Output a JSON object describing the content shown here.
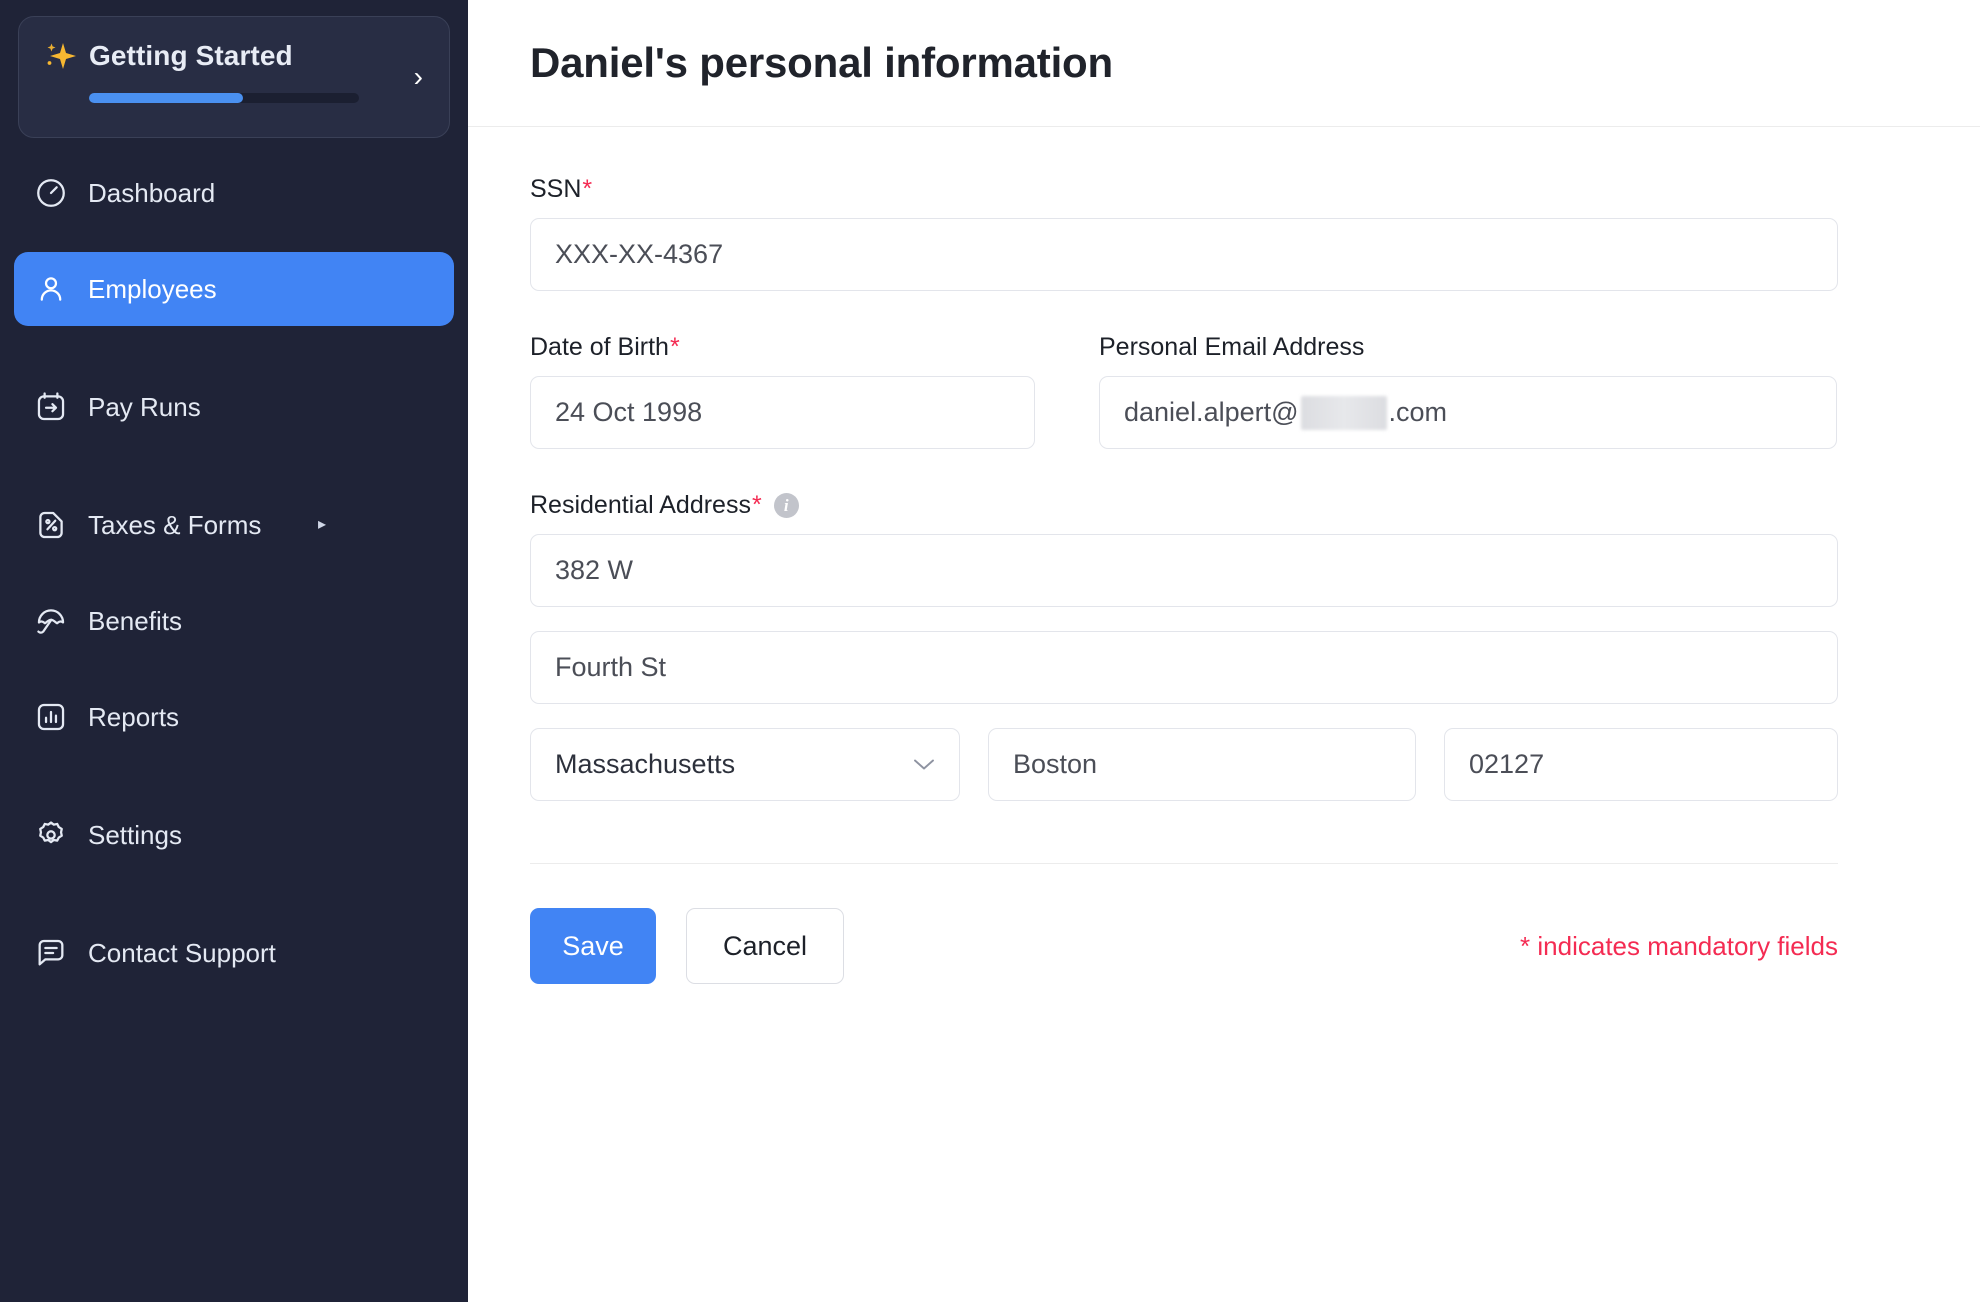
{
  "sidebar": {
    "getting_started": {
      "title": "Getting Started",
      "progress_percent": 57,
      "chevron": "›",
      "sparkle_icon": "sparkle-icon"
    },
    "items": [
      {
        "label": "Dashboard",
        "icon": "gauge-icon",
        "active": false,
        "expandable": false
      },
      {
        "label": "Employees",
        "icon": "person-icon",
        "active": true,
        "expandable": false
      },
      {
        "label": "Pay Runs",
        "icon": "calendar-arrow-icon",
        "active": false,
        "expandable": false
      },
      {
        "label": "Taxes & Forms",
        "icon": "percent-document-icon",
        "active": false,
        "expandable": true,
        "expand_glyph": "▸"
      },
      {
        "label": "Benefits",
        "icon": "umbrella-icon",
        "active": false,
        "expandable": false
      },
      {
        "label": "Reports",
        "icon": "bar-chart-icon",
        "active": false,
        "expandable": false
      },
      {
        "label": "Settings",
        "icon": "gear-icon",
        "active": false,
        "expandable": false
      },
      {
        "label": "Contact Support",
        "icon": "chat-bubble-icon",
        "active": false,
        "expandable": false
      }
    ]
  },
  "header": {
    "title": "Daniel's personal information"
  },
  "form": {
    "ssn": {
      "label": "SSN",
      "required_marker": "*",
      "value": "XXX-XX-4367"
    },
    "date_of_birth": {
      "label": "Date of Birth",
      "required_marker": "*",
      "value": "24 Oct 1998"
    },
    "personal_email": {
      "label": "Personal Email Address",
      "value_prefix": "daniel.alpert@",
      "value_suffix": ".com",
      "redacted": true
    },
    "residential_address": {
      "label": "Residential Address",
      "required_marker": "*",
      "info_icon": "info-icon",
      "info_glyph": "i",
      "line1": "382 W",
      "line2": "Fourth St",
      "state": "Massachusetts",
      "state_chevron": "⌄",
      "city": "Boston",
      "zip": "02127"
    }
  },
  "footer": {
    "save_label": "Save",
    "cancel_label": "Cancel",
    "mandatory_note": "* indicates mandatory fields"
  },
  "colors": {
    "sidebar_bg": "#1f2337",
    "card_bg": "#282d44",
    "accent_blue": "#4184f4",
    "required_red": "#f42b52",
    "sparkle_gold": "#f7b731",
    "input_border": "#e3e5eb"
  }
}
